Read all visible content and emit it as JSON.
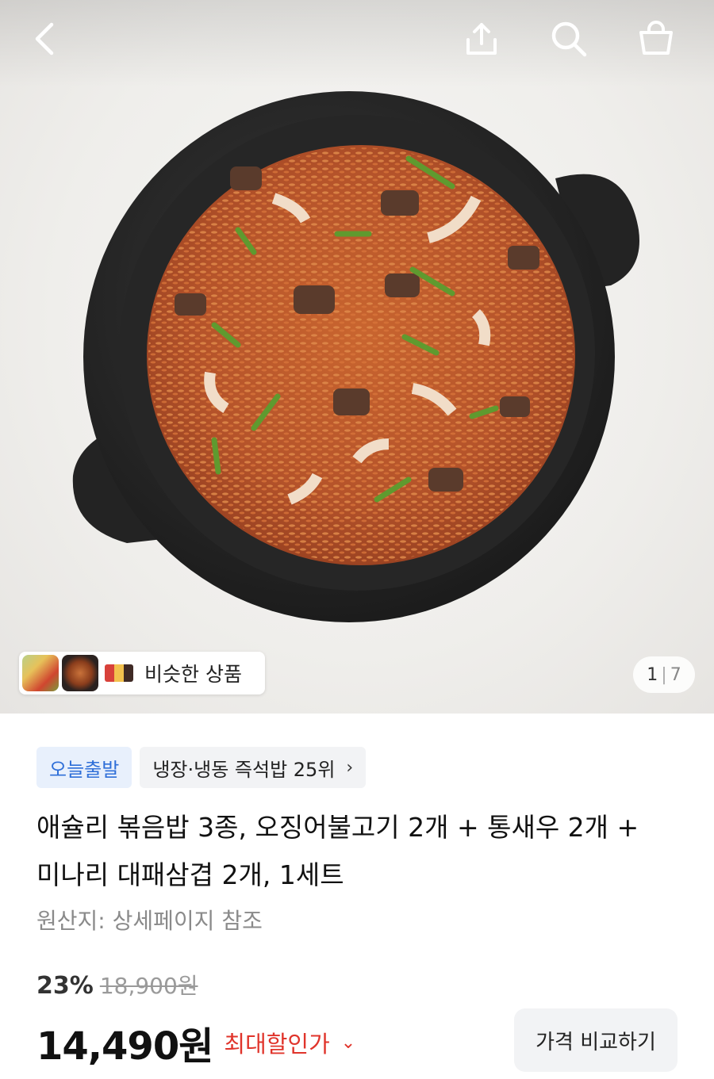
{
  "header": {
    "back_icon": "chevron-left-icon",
    "share_icon": "share-icon",
    "search_icon": "search-icon",
    "cart_icon": "shopping-bag-icon"
  },
  "gallery": {
    "similar_label": "비슷한 상품",
    "current_page": "1",
    "total_pages": "7"
  },
  "badges": {
    "dispatch": "오늘출발",
    "rank": "냉장·냉동 즉석밥 25위"
  },
  "product": {
    "title_line1": "애슐리 볶음밥 3종, 오징어불고기 2개 + 통새우 2개 +",
    "title_line2": "미나리 대패삼겹 2개, 1세트",
    "origin": "원산지: 상세페이지 참조"
  },
  "price": {
    "discount_rate": "23%",
    "original": "18,900원",
    "sale": "14,490원",
    "max_discount_label": "최대할인가",
    "compare_button": "가격 비교하기"
  },
  "colors": {
    "accent_blue": "#2f6fd8",
    "discount_red": "#e0342b",
    "badge_bg": "#e8f0fc"
  }
}
